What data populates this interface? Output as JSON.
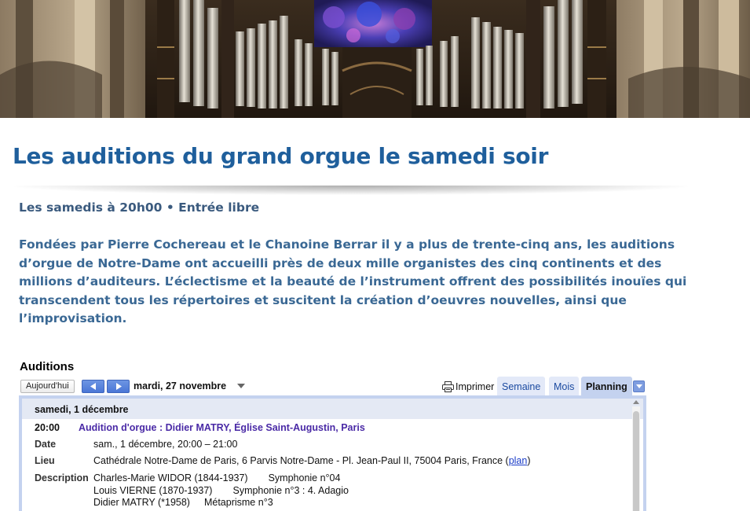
{
  "article": {
    "title": "Les auditions du grand orgue le samedi soir",
    "subtitle": "Les samedis à 20h00 • Entrée libre",
    "intro": "Fondées par Pierre Cochereau et le Chanoine Berrar il y a plus de trente-cinq ans, les auditions d’orgue de Notre-Dame ont accueilli près de deux mille organistes des cinq continents et des millions d’auditeurs. L’éclectisme et la beauté de l’instrument offrent des possibilités inouïes qui transcendent tous les répertoires et suscitent la création d’oeuvres nouvelles, ainsi que l’improvisation."
  },
  "calendar": {
    "title": "Auditions",
    "today_label": "Aujourd'hui",
    "current_date": "mardi, 27 novembre",
    "print_label": "Imprimer",
    "tabs": [
      {
        "label": "Semaine",
        "active": false
      },
      {
        "label": "Mois",
        "active": false
      },
      {
        "label": "Planning",
        "active": true
      }
    ],
    "day_header": "samedi, 1 décembre",
    "event": {
      "time": "20:00",
      "title": "Audition d'orgue : Didier MATRY, Église Saint-Augustin, Paris",
      "date_label": "Date",
      "date_value": "sam., 1 décembre, 20:00 – 21:00",
      "place_label": "Lieu",
      "place_value": "Cathédrale Notre-Dame de Paris, 6 Parvis Notre-Dame - Pl. Jean-Paul II, 75004 Paris, France (",
      "map_link": "plan",
      "place_close": ")",
      "description_label": "Description",
      "description": [
        {
          "composer": "Charles-Marie WIDOR (1844-1937)",
          "work": "Symphonie n°04"
        },
        {
          "composer": "Louis VIERNE (1870-1937)",
          "work": "Symphonie n°3 : 4. Adagio"
        },
        {
          "composer": "Didier MATRY (*1958)",
          "work": "Métaprisme n°3"
        }
      ]
    }
  },
  "colors": {
    "title_blue": "#1f5f9c",
    "text_blue": "#3a6894",
    "event_purple": "#4a2aa6",
    "calendar_frame": "#c4d2ef"
  }
}
